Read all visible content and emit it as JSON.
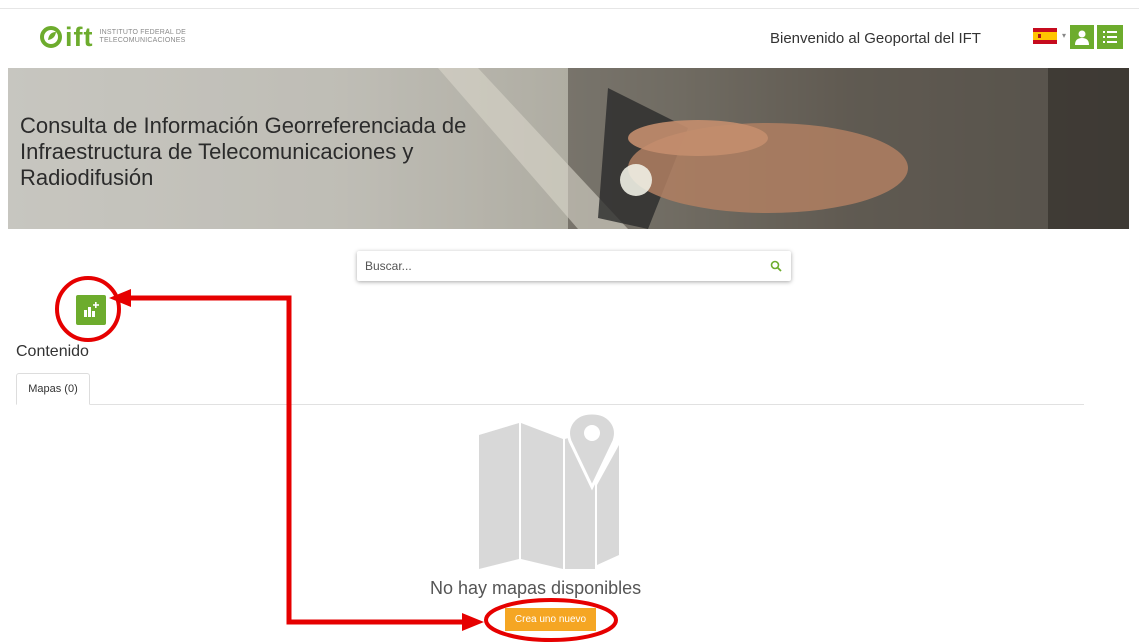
{
  "header": {
    "logo_abbrev": "ift",
    "logo_name_line1": "INSTITUTO FEDERAL DE",
    "logo_name_line2": "TELECOMUNICACIONES",
    "welcome": "Bienvenido al Geoportal del IFT",
    "language_flag": "mexico-spain-flag-icon",
    "caret": "▾"
  },
  "banner": {
    "title": "Consulta de Información Georreferenciada de Infraestructura de Telecomunicaciones y Radiodifusión"
  },
  "search": {
    "placeholder": "Buscar...",
    "value": ""
  },
  "content": {
    "heading": "Contenido",
    "tabs": [
      {
        "label": "Mapas (0)",
        "active": true
      }
    ],
    "empty_message": "No hay mapas disponibles",
    "create_button": "Crea uno nuevo"
  },
  "colors": {
    "brand_green": "#6dac2d",
    "create_orange": "#f5a623",
    "annotation_red": "#e60000"
  },
  "icons": {
    "search": "search-icon",
    "add_map": "add-map-icon",
    "user": "user-icon",
    "menu": "list-icon",
    "empty": "map-pin-icon"
  }
}
